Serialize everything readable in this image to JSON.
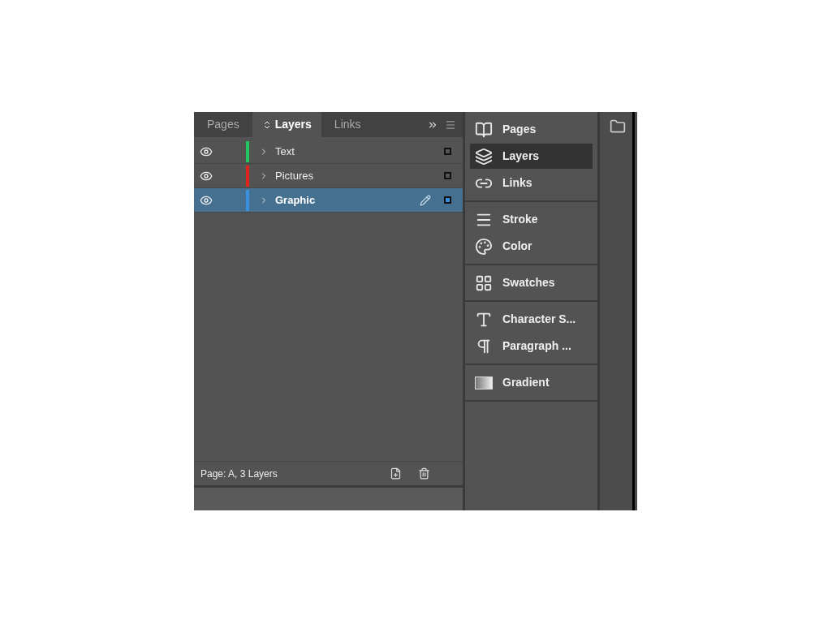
{
  "panel": {
    "tabs": [
      {
        "label": "Pages",
        "selected": false
      },
      {
        "label": "Layers",
        "selected": true
      },
      {
        "label": "Links",
        "selected": false
      }
    ],
    "layers": [
      {
        "name": "Text",
        "color": "#22c55e",
        "visible": true,
        "selected": false
      },
      {
        "name": "Pictures",
        "color": "#e0261b",
        "visible": true,
        "selected": false
      },
      {
        "name": "Graphic",
        "color": "#3b8fe0",
        "visible": true,
        "selected": true
      }
    ],
    "footer": "Page: A, 3 Layers"
  },
  "dock": {
    "groups": [
      [
        {
          "kind": "pages",
          "label": "Pages",
          "selected": false
        },
        {
          "kind": "layers",
          "label": "Layers",
          "selected": true
        },
        {
          "kind": "links",
          "label": "Links",
          "selected": false
        }
      ],
      [
        {
          "kind": "stroke",
          "label": "Stroke",
          "selected": false
        },
        {
          "kind": "color",
          "label": "Color",
          "selected": false
        }
      ],
      [
        {
          "kind": "swatches",
          "label": "Swatches",
          "selected": false
        }
      ],
      [
        {
          "kind": "character",
          "label": "Character S...",
          "selected": false
        },
        {
          "kind": "paragraph",
          "label": "Paragraph ...",
          "selected": false
        }
      ],
      [
        {
          "kind": "gradient",
          "label": "Gradient",
          "selected": false
        }
      ]
    ]
  }
}
